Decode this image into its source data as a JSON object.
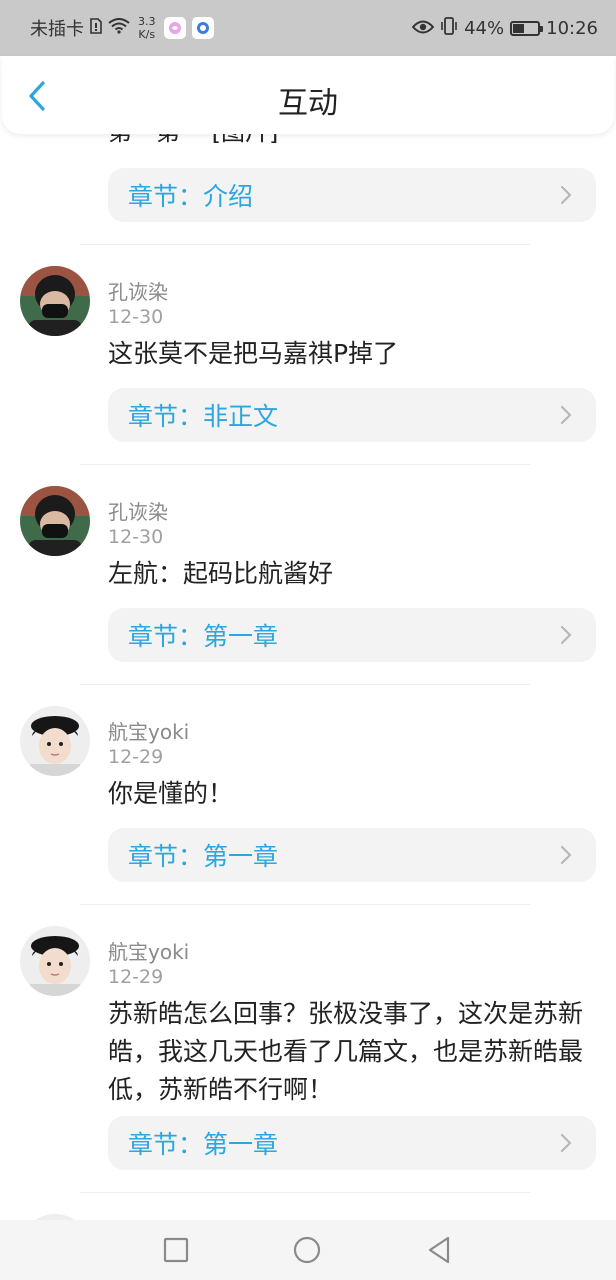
{
  "status_bar": {
    "carrier": "未插卡",
    "speed_value": "3.3",
    "speed_unit": "K/s",
    "battery": "44%",
    "battery_level": 0.44,
    "time": "10:26"
  },
  "header": {
    "title": "互动"
  },
  "partial_comment": {
    "text": "第一第一 [图片]",
    "chapter": "章节：介绍"
  },
  "comments": [
    {
      "user": "孔诙染",
      "date": "12-30",
      "text": "这张莫不是把马嘉祺P掉了",
      "chapter": "章节：非正文",
      "avatar": "avatar-masked-boy"
    },
    {
      "user": "孔诙染",
      "date": "12-30",
      "text": "左航：起码比航酱好",
      "chapter": "章节：第一章",
      "avatar": "avatar-masked-boy"
    },
    {
      "user": "航宝yoki",
      "date": "12-29",
      "text": "你是懂的！",
      "chapter": "章节：第一章",
      "avatar": "avatar-hat-boy"
    },
    {
      "user": "航宝yoki",
      "date": "12-29",
      "text": "苏新皓怎么回事？张极没事了，这次是苏新皓，我这几天也看了几篇文，也是苏新皓最低，苏新皓不行啊！",
      "chapter": "章节：第一章",
      "avatar": "avatar-hat-boy"
    }
  ],
  "colors": {
    "accent": "#2ba6de",
    "status_bar": "#c9c9c9",
    "chapter_bg": "#f3f3f3"
  },
  "nav": {
    "icons": [
      "square-icon",
      "circle-icon",
      "triangle-back-icon"
    ]
  }
}
